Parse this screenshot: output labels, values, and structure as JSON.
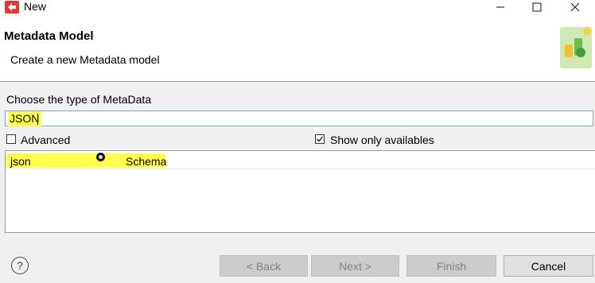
{
  "window": {
    "title": "New"
  },
  "banner": {
    "title": "Metadata Model",
    "description": "Create a new Metadata model"
  },
  "form": {
    "type_label": "Choose the type of MetaData",
    "filter_value": "JSON",
    "advanced_label": "Advanced",
    "advanced_checked": false,
    "show_available_label": "Show only availables",
    "show_available_checked": true
  },
  "list": {
    "rows": [
      {
        "name": "json",
        "description": "Schema"
      }
    ]
  },
  "buttons": {
    "back": "< Back",
    "next": "Next >",
    "finish": "Finish",
    "cancel": "Cancel",
    "help": "?"
  },
  "colors": {
    "highlight": "#ffff4d",
    "app_icon": "#e03a2f",
    "disabled_button": "#cccccc"
  }
}
